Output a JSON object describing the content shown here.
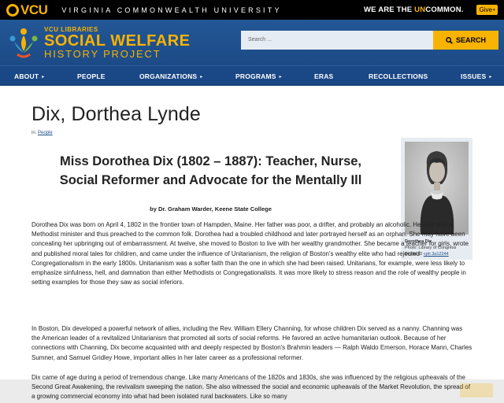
{
  "vcu": {
    "logo_text": "VCU",
    "university_name": "VIRGINIA COMMONWEALTH UNIVERSITY",
    "slogan_pre": "WE ARE THE ",
    "slogan_hl": "UN",
    "slogan_post": "COMMON.",
    "give_label": "Give"
  },
  "header": {
    "sub": "VCU LIBRARIES",
    "main": "SOCIAL WELFARE",
    "hist": "HISTORY PROJECT",
    "search_placeholder": "Search ...",
    "search_label": "SEARCH"
  },
  "nav": {
    "items": [
      {
        "label": "ABOUT",
        "arrow": "▸"
      },
      {
        "label": "PEOPLE",
        "arrow": ""
      },
      {
        "label": "ORGANIZATIONS",
        "arrow": "▸"
      },
      {
        "label": "PROGRAMS",
        "arrow": "▸"
      },
      {
        "label": "ERAS",
        "arrow": ""
      },
      {
        "label": "RECOLLECTIONS",
        "arrow": ""
      },
      {
        "label": "ISSUES",
        "arrow": "▸"
      }
    ]
  },
  "page": {
    "title": "Dix, Dorthea Lynde",
    "in_label": "in: ",
    "in_link": "People",
    "article_title_l1": "Miss Dorothea Dix (1802 – 1887): Teacher, Nurse,",
    "article_title_l2": "Social Reformer and Advocate for the Mentally Ill",
    "byline": "by Dr. Graham Warder, Keene State College"
  },
  "photo": {
    "name": "Dorothea Dix",
    "credit": "Photo: Library of Congress",
    "digital_id_label": "Digital ID ",
    "digital_id": "cph 3a12244"
  },
  "body": {
    "p1": "Dorothea Dix was born on April 4, 1802 in the frontier town of Hampden, Maine. Her father was poor, a drifter, and probably an alcoholic. He was also a Methodist minister and thus preached to the common folk. Dorothea had a troubled childhood and later portrayed herself as an orphan. She may have been concealing her upbringing out of embarrassment. At twelve, she moved to Boston to live with her wealthy grandmother. She became a teacher for girls, wrote and published moral tales for children, and came under the influence of Unitarianism, the religion of Boston's wealthy elite who had rejected Congregationalism in the early 1800s. Unitarianism was a softer faith than the one in which she had been raised. Unitarians, for example, were less likely to emphasize sinfulness, hell, and damnation than either Methodists or Congregationalists. It was more likely to stress reason and the role of wealthy people in setting examples for those they saw as social inferiors.",
    "p2": "In Boston, Dix developed a powerful network of allies, including the Rev. William Ellery Channing, for whose children Dix served as a nanny. Channing was the American leader of a revitalized Unitarianism that promoted all sorts of social reforms. He favored an active humanitarian outlook. Because of her connections with Channing, Dix become acquainted with and deeply respected by Boston's Brahmin leaders — Ralph Waldo Emerson, Horace Mann, Charles Sumner, and Samuel Gridley Howe, important allies in her later career as a professional reformer.",
    "p3": "Dix came of age during a period of tremendous change. Like many Americans of the 1820s and 1830s, she was influenced by the religious upheavals of the Second Great Awakening, the revivalism sweeping the nation. She also witnessed the social and economic upheavals of the Market Revolution, the spread of a growing commercial economy into what had been isolated rural backwaters. Like so many"
  },
  "colors": {
    "vcu_gold": "#f8b300",
    "header_blue": "#1f4d8c",
    "link_blue": "#1f4d8c"
  }
}
